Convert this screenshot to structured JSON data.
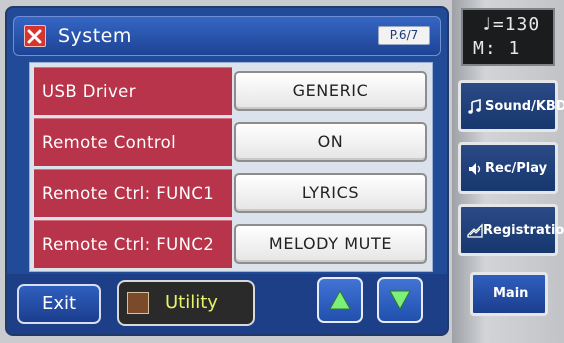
{
  "header": {
    "title": "System",
    "page_indicator": "P.6/7"
  },
  "settings": [
    {
      "label": "USB Driver",
      "value": "GENERIC"
    },
    {
      "label": "Remote Control",
      "value": "ON"
    },
    {
      "label": "Remote Ctrl: FUNC1",
      "value": "LYRICS"
    },
    {
      "label": "Remote Ctrl: FUNC2",
      "value": "MELODY MUTE"
    }
  ],
  "footer": {
    "exit_label": "Exit",
    "utility_label": "Utility",
    "scroll_up_icon": "triangle-up",
    "scroll_down_icon": "triangle-down"
  },
  "sidebar": {
    "tempo_line": "♩=130",
    "measure_line": "M:  1",
    "buttons": [
      {
        "label": "Sound/KBD",
        "icon": "music-notes-icon"
      },
      {
        "label": "Rec/Play",
        "icon": "speaker-icon"
      },
      {
        "label": "Registration",
        "icon": "registration-icon"
      }
    ],
    "main_label": "Main"
  },
  "colors": {
    "panel_bg": "#214a97",
    "row_label_bg": "#b8344a",
    "utility_text": "#e9f36a",
    "arrow_button": "#2f62c8"
  }
}
